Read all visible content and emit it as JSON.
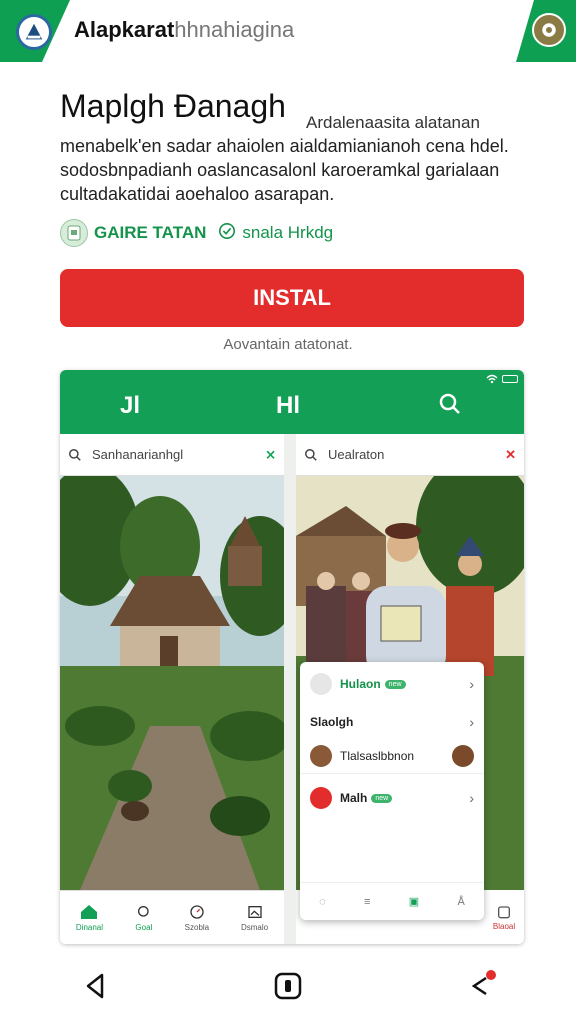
{
  "topbar": {
    "app_name_bold": "Alapkarat",
    "app_name_rest": "hhnahiagina",
    "logo_icon": "triangle-logo-icon",
    "profile_icon": "avatar-icon"
  },
  "hero": {
    "title": "Maplgh Đanagh",
    "side_note": "Ardalenaasita alatanan",
    "description": "menabelk'en sadar ahaiolen aialdamianianoh cena hdel. sodosbnpadianh oaslancasalonl karoeramkal garialaan cultadakatidai aoehaloo asarapan."
  },
  "meta": {
    "developer": "GAIRE TATAN",
    "tag": "snala Hrkdg"
  },
  "install": {
    "label": "INSTAL",
    "subtext": "Aovantain atatonat."
  },
  "screenshot": {
    "header_nav": [
      "Jl",
      "Hl",
      "search"
    ],
    "left_panel": {
      "search_text": "Sanhanarianhgl",
      "bottom_nav": [
        "Dinanal",
        "Goal",
        "Szobla",
        "Dsmalo"
      ]
    },
    "right_panel": {
      "search_text": "Uealraton",
      "card_rows": [
        {
          "title": "Hulaon",
          "pill": "new"
        },
        {
          "title": "Slaolgh",
          "pill": ""
        },
        {
          "title": "Tlalsaslbbnon",
          "pill": ""
        },
        {
          "title": "Malh",
          "pill": "new"
        }
      ],
      "bottom_label": "Blaoal"
    }
  },
  "colors": {
    "brand_green": "#13a056",
    "install_red": "#e32d2d"
  }
}
